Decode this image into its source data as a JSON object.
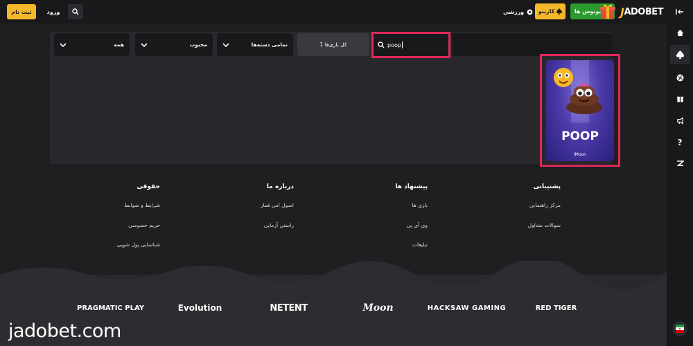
{
  "header": {
    "register_label": "ثبت نام",
    "login_label": "ورود",
    "sport_label": "ورزشی",
    "casino_label": "کازینو",
    "bonus_label": "بونوس ها",
    "logo_text": "ADOBET",
    "logo_initial": "J"
  },
  "search": {
    "query": "poop",
    "count_label": "1 کل بازی‌ها",
    "sort_label": "محبوب",
    "category_label": "تمامی دسته‌ها",
    "provider_label": "همه"
  },
  "game": {
    "title": "POOP",
    "provider": "iMoon"
  },
  "footer": {
    "columns": [
      {
        "title": "پشتیبانی",
        "links": [
          "مرکز راهنمایی",
          "سوالات متداول"
        ]
      },
      {
        "title": "پیشنهاد ها",
        "links": [
          "بازی ها",
          "وی آی پی",
          "تبلیغات"
        ]
      },
      {
        "title": "درباره ما",
        "links": [
          "اصول امن قمار",
          "راستی آزمایی"
        ]
      },
      {
        "title": "حقوقی",
        "links": [
          "شرایط و ضوابط",
          "حریم خصوصی",
          "شناسایی پول شویی"
        ]
      }
    ],
    "providers": [
      "PRAGMATIC PLAY",
      "Evolution",
      "NETENT",
      "Moon",
      "HACKSAW GAMING",
      "RED TIGER"
    ]
  },
  "watermark": "jadobet.com",
  "colors": {
    "accent": "#f5b82a",
    "green": "#2b9a2f",
    "highlight": "#e0285a"
  }
}
